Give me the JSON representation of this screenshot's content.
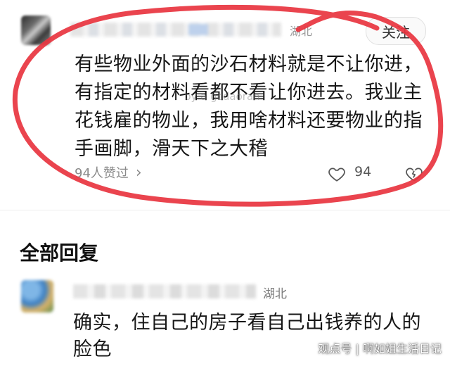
{
  "post": {
    "location": "湖北",
    "follow_label": "关注",
    "text": "有些物业外面的沙石材料就是不让你进，有指定的材料看都不看让你进去。我业主花钱雇的物业，我用啥材料还要物业的指手画脚，滑天下之大稽",
    "likes_text": "94人赞过",
    "like_count": "94",
    "watermark": "by a gcdaoran"
  },
  "replies": {
    "section_title": "全部回复",
    "items": [
      {
        "location": "湖北",
        "text": "确实，住自己的房子看自己出钱养的人的脸色"
      }
    ]
  },
  "footer": {
    "watermark": "观点号 | 啊如姐生活日记"
  },
  "colors": {
    "annotation": "#e8343f",
    "secondary_text": "#8a8a8a"
  },
  "icons": [
    "heart-icon",
    "broken-heart-icon",
    "chevron-right-icon"
  ]
}
